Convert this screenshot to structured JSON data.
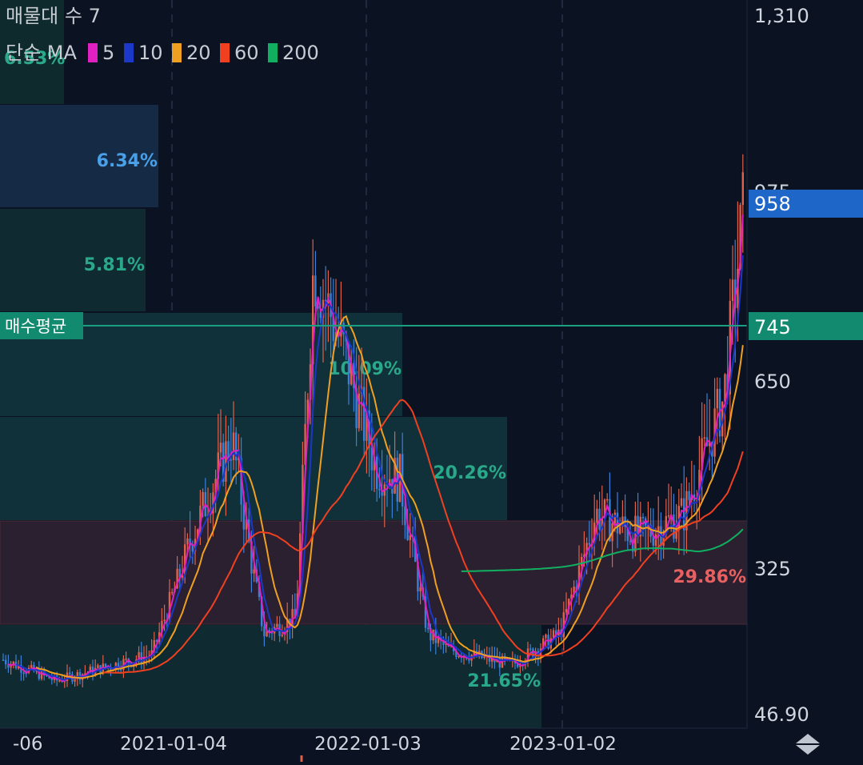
{
  "header": {
    "title": "매물대 수 7",
    "ma_prefix": "단순 MA",
    "ma_legend": [
      {
        "label": "5",
        "color": "#e020c0"
      },
      {
        "label": "10",
        "color": "#1c38c8"
      },
      {
        "label": "20",
        "color": "#f0a020"
      },
      {
        "label": "60",
        "color": "#f04020"
      },
      {
        "label": "200",
        "color": "#10b060"
      }
    ]
  },
  "colors": {
    "background": "#0b1221",
    "up_candle": "#e0604a",
    "down_candle": "#3a80d8",
    "avg_line": "#1aa080",
    "price_badge": "#1e66c8",
    "avg_badge": "#128a70"
  },
  "chart_data": {
    "type": "candlestick",
    "price_axis_labels": [
      "1,310",
      "975",
      "958",
      "745",
      "650",
      "325",
      "46.90"
    ],
    "date_axis_labels": [
      "-06",
      "2021-01-04",
      "2022-01-03",
      "2023-01-02"
    ],
    "current_price": "958",
    "buy_average_label": "매수평균",
    "buy_average_price": "745",
    "price_range": [
      46.9,
      1310
    ],
    "volume_profile": [
      {
        "label": "6.53%",
        "price_low": 1120,
        "price_high": 1310
      },
      {
        "label": "6.34%",
        "price_low": 1000,
        "price_high": 1120
      },
      {
        "label": "5.81%",
        "price_low": 850,
        "price_high": 1000
      },
      {
        "label": "10.09%",
        "price_low": 650,
        "price_high": 850
      },
      {
        "label": "20.26%",
        "price_low": 460,
        "price_high": 650
      },
      {
        "label": "29.86%",
        "price_low": 250,
        "price_high": 460
      },
      {
        "label": "21.65%",
        "price_low": 46.9,
        "price_high": 250
      }
    ],
    "approx_close_path": [
      {
        "date": "2020-06",
        "close": 150
      },
      {
        "date": "2020-09",
        "close": 110
      },
      {
        "date": "2020-12",
        "close": 160
      },
      {
        "date": "2021-02",
        "close": 380
      },
      {
        "date": "2021-03",
        "close": 550
      },
      {
        "date": "2021-05",
        "close": 200
      },
      {
        "date": "2021-08",
        "close": 230
      },
      {
        "date": "2021-09",
        "close": 850
      },
      {
        "date": "2021-11",
        "close": 700
      },
      {
        "date": "2022-01",
        "close": 500
      },
      {
        "date": "2022-03",
        "close": 480
      },
      {
        "date": "2022-05",
        "close": 200
      },
      {
        "date": "2022-07",
        "close": 170
      },
      {
        "date": "2022-10",
        "close": 140
      },
      {
        "date": "2023-01",
        "close": 200
      },
      {
        "date": "2023-03",
        "close": 420
      },
      {
        "date": "2023-06",
        "close": 380
      },
      {
        "date": "2023-09",
        "close": 420
      },
      {
        "date": "2023-11",
        "close": 620
      },
      {
        "date": "2023-12",
        "close": 958
      }
    ]
  }
}
